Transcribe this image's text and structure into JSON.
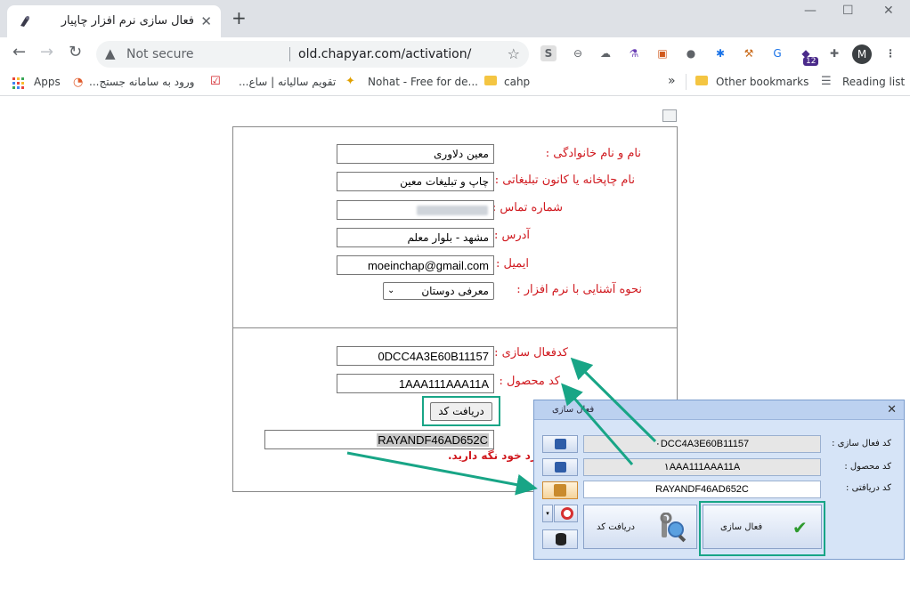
{
  "browser": {
    "tab_title": "فعال سازی نرم افزار چاپیار",
    "tab_close": "✕",
    "new_tab": "+",
    "security_label": "Not secure",
    "url": "old.chapyar.com/activation/",
    "profile_initial": "M",
    "extension_badge": "12"
  },
  "bookmarks": [
    {
      "label": "Apps"
    },
    {
      "label": "ورود به سامانه جستج..."
    },
    {
      "label": "تقویم سالیانه | ساع..."
    },
    {
      "label": "Nohat - Free for de..."
    },
    {
      "label": "cahp"
    },
    {
      "label": "»"
    },
    {
      "label": "Other bookmarks"
    },
    {
      "label": "Reading list"
    }
  ],
  "form": {
    "name_label": "نام و نام خانوادگی :",
    "name_value": "معین دلاوری",
    "shop_label": "نام چاپخانه یا کانون تبلیغاتی :",
    "shop_value": "چاپ و تبلیغات معین",
    "phone_label": "شماره تماس :",
    "address_label": "آدرس :",
    "address_value": "مشهد - بلوار معلم",
    "email_label": "ایمیل :",
    "email_value": "moeinchap@gmail.com",
    "source_label": "نحوه آشنایی با نرم افزار :",
    "source_value": "معرفی دوستان",
    "activation_label": "کدفعال سازی :",
    "activation_value": "0DCC4A3E60B11157",
    "product_label": "کد محصول :",
    "product_value": "1AAA111AAA11A",
    "get_code_button": "دریافت کد",
    "result_value": "RAYANDF46AD652C",
    "note": "زد خود نگه دارید."
  },
  "dialog": {
    "title": "فعال سازی",
    "close": "✕",
    "activation_label": "کد فعال سازی :",
    "activation_value": "٠DCC4A3E60B11157",
    "product_label": "کد محصول :",
    "product_value": "١AAA111AAA11A",
    "received_label": "کد دریافتی :",
    "received_value": "RAYANDF46AD652C",
    "activate_button": "فعال سازی",
    "get_code_button": "دریافت کد"
  },
  "colors": {
    "label_red": "#d0181e",
    "highlight_green": "#18a586",
    "dialog_bg": "#d6e4f7"
  }
}
